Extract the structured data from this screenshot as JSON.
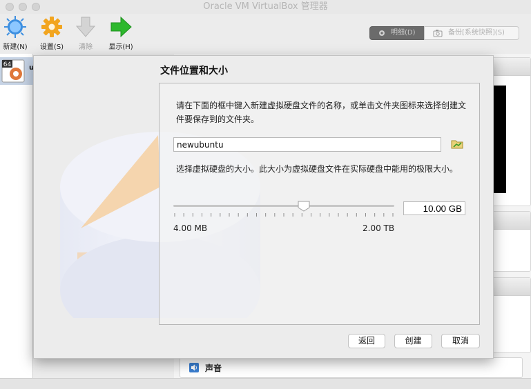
{
  "window": {
    "title": "Oracle VM VirtualBox 管理器"
  },
  "toolbar": {
    "new_label": "新建(N)",
    "settings_label": "设置(S)",
    "discard_label": "清除",
    "show_label": "显示(H)"
  },
  "view_switch": {
    "details_label": "明细(D)",
    "snapshots_label": "备份[系统快照](S)"
  },
  "vm_list": {
    "badge": "64",
    "name_fragment": "u"
  },
  "details_panel": {
    "sound_label": "声音"
  },
  "dialog": {
    "title": "文件位置和大小",
    "location_description": "请在下面的框中键入新建虚拟硬盘文件的名称，或单击文件夹图标来选择创建文件要保存到的文件夹。",
    "filename_value": "newubuntu",
    "size_description": "选择虚拟硬盘的大小。此大小为虚拟硬盘文件在实际硬盘中能用的极限大小。",
    "size_value": "10.00 GB",
    "min_label": "4.00 MB",
    "max_label": "2.00 TB",
    "slider_fraction": 0.59,
    "buttons": {
      "back": "返回",
      "create": "创建",
      "cancel": "取消"
    }
  },
  "colors": {
    "selection": "#c6d3e5",
    "new_icon": "#3d8fe0",
    "settings_icon": "#f2a51f",
    "show_icon": "#2eb82e",
    "pie_orange": "#f7c98e"
  },
  "icons": {
    "new": "new-sun-icon",
    "settings": "gear-icon",
    "discard": "down-arrow-icon",
    "show": "right-arrow-icon",
    "folder": "folder-icon"
  }
}
